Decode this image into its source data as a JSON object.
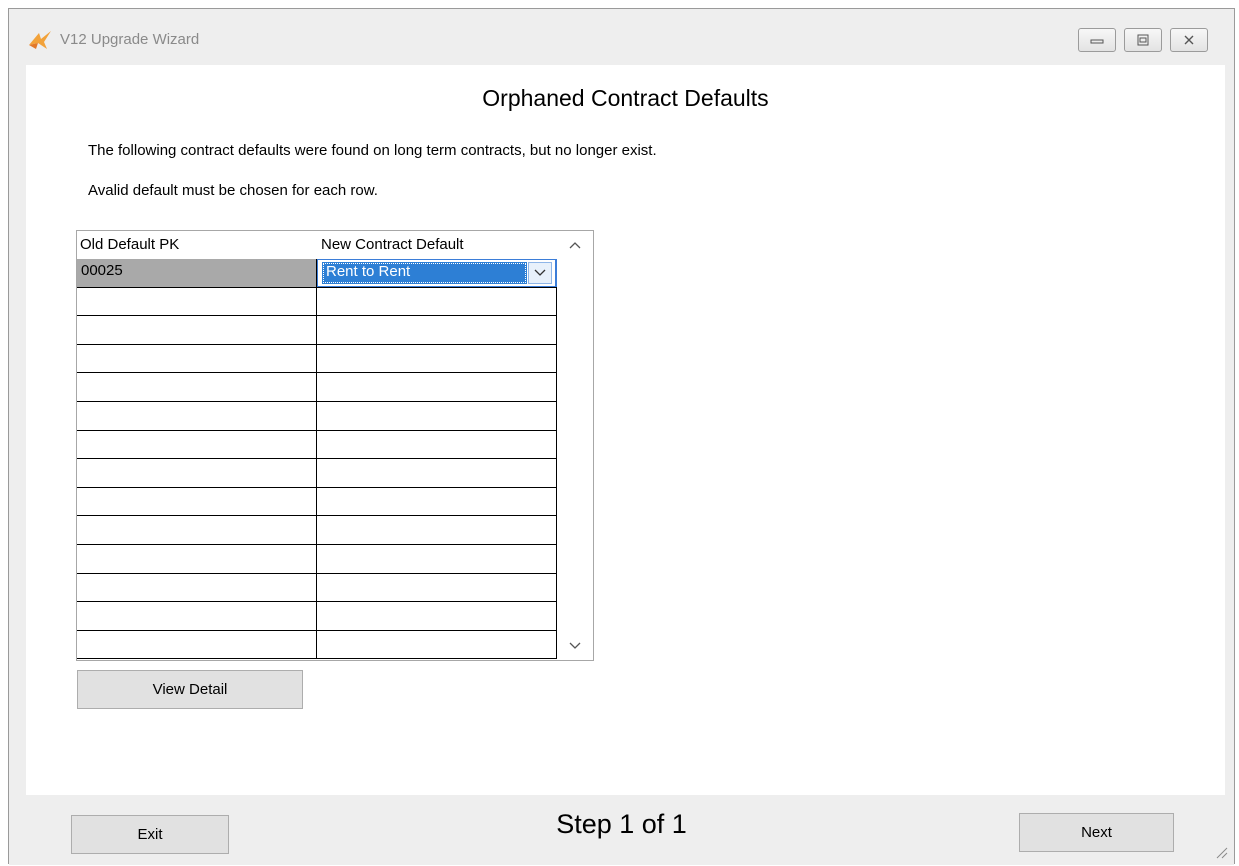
{
  "window": {
    "title": "V12 Upgrade Wizard",
    "icons": {
      "app": "v12-logo-icon",
      "minimize": "minimize-icon",
      "maximize": "maximize-icon",
      "close": "close-icon"
    }
  },
  "page": {
    "title": "Orphaned Contract Defaults",
    "info_line1": "The following contract defaults were found on long term contracts, but no longer exist.",
    "info_line2": "Avalid default must be chosen for each row."
  },
  "grid": {
    "columns": [
      "Old Default PK",
      "New Contract Default"
    ],
    "rows": [
      {
        "old_pk": "00025",
        "new_default": "Rent to Rent",
        "selected": true
      }
    ],
    "empty_rows": 13
  },
  "buttons": {
    "view_detail": "View Detail",
    "exit": "Exit",
    "next": "Next"
  },
  "footer": {
    "step": "Step 1 of 1"
  },
  "colors": {
    "accent": "#2d7fd5",
    "selected_cell": "#a9a9a9",
    "window_bg": "#eeeeee"
  }
}
